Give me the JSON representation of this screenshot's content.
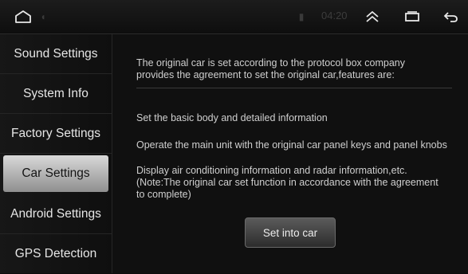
{
  "statusbar": {
    "time": "04:20",
    "home_icon": "home-outline-icon",
    "expand_icon": "double-chevron-up-icon",
    "recents_icon": "recent-apps-icon",
    "back_icon": "back-arrow-icon"
  },
  "sidebar": {
    "items": [
      {
        "label": "Sound Settings"
      },
      {
        "label": "System Info"
      },
      {
        "label": "Factory Settings"
      },
      {
        "label": "Car Settings",
        "active": true
      },
      {
        "label": "Android Settings"
      },
      {
        "label": "GPS Detection"
      }
    ]
  },
  "content": {
    "intro_line1": "The original car is set according to the protocol box company",
    "intro_line2": "provides the agreement to set the original car,features are:",
    "feature1": "Set the basic body and detailed information",
    "feature2": "Operate the main unit with the original car panel keys and panel knobs",
    "feature3_line1": "Display air conditioning information and radar information,etc.",
    "feature3_line2": "(Note:The original car set function in accordance with the agreement",
    "feature3_line3": "to complete)",
    "button_label": "Set into car"
  },
  "colors": {
    "background": "#0c0c0c",
    "active_tab": "#cfcfcf",
    "text": "#d8d8d8"
  }
}
